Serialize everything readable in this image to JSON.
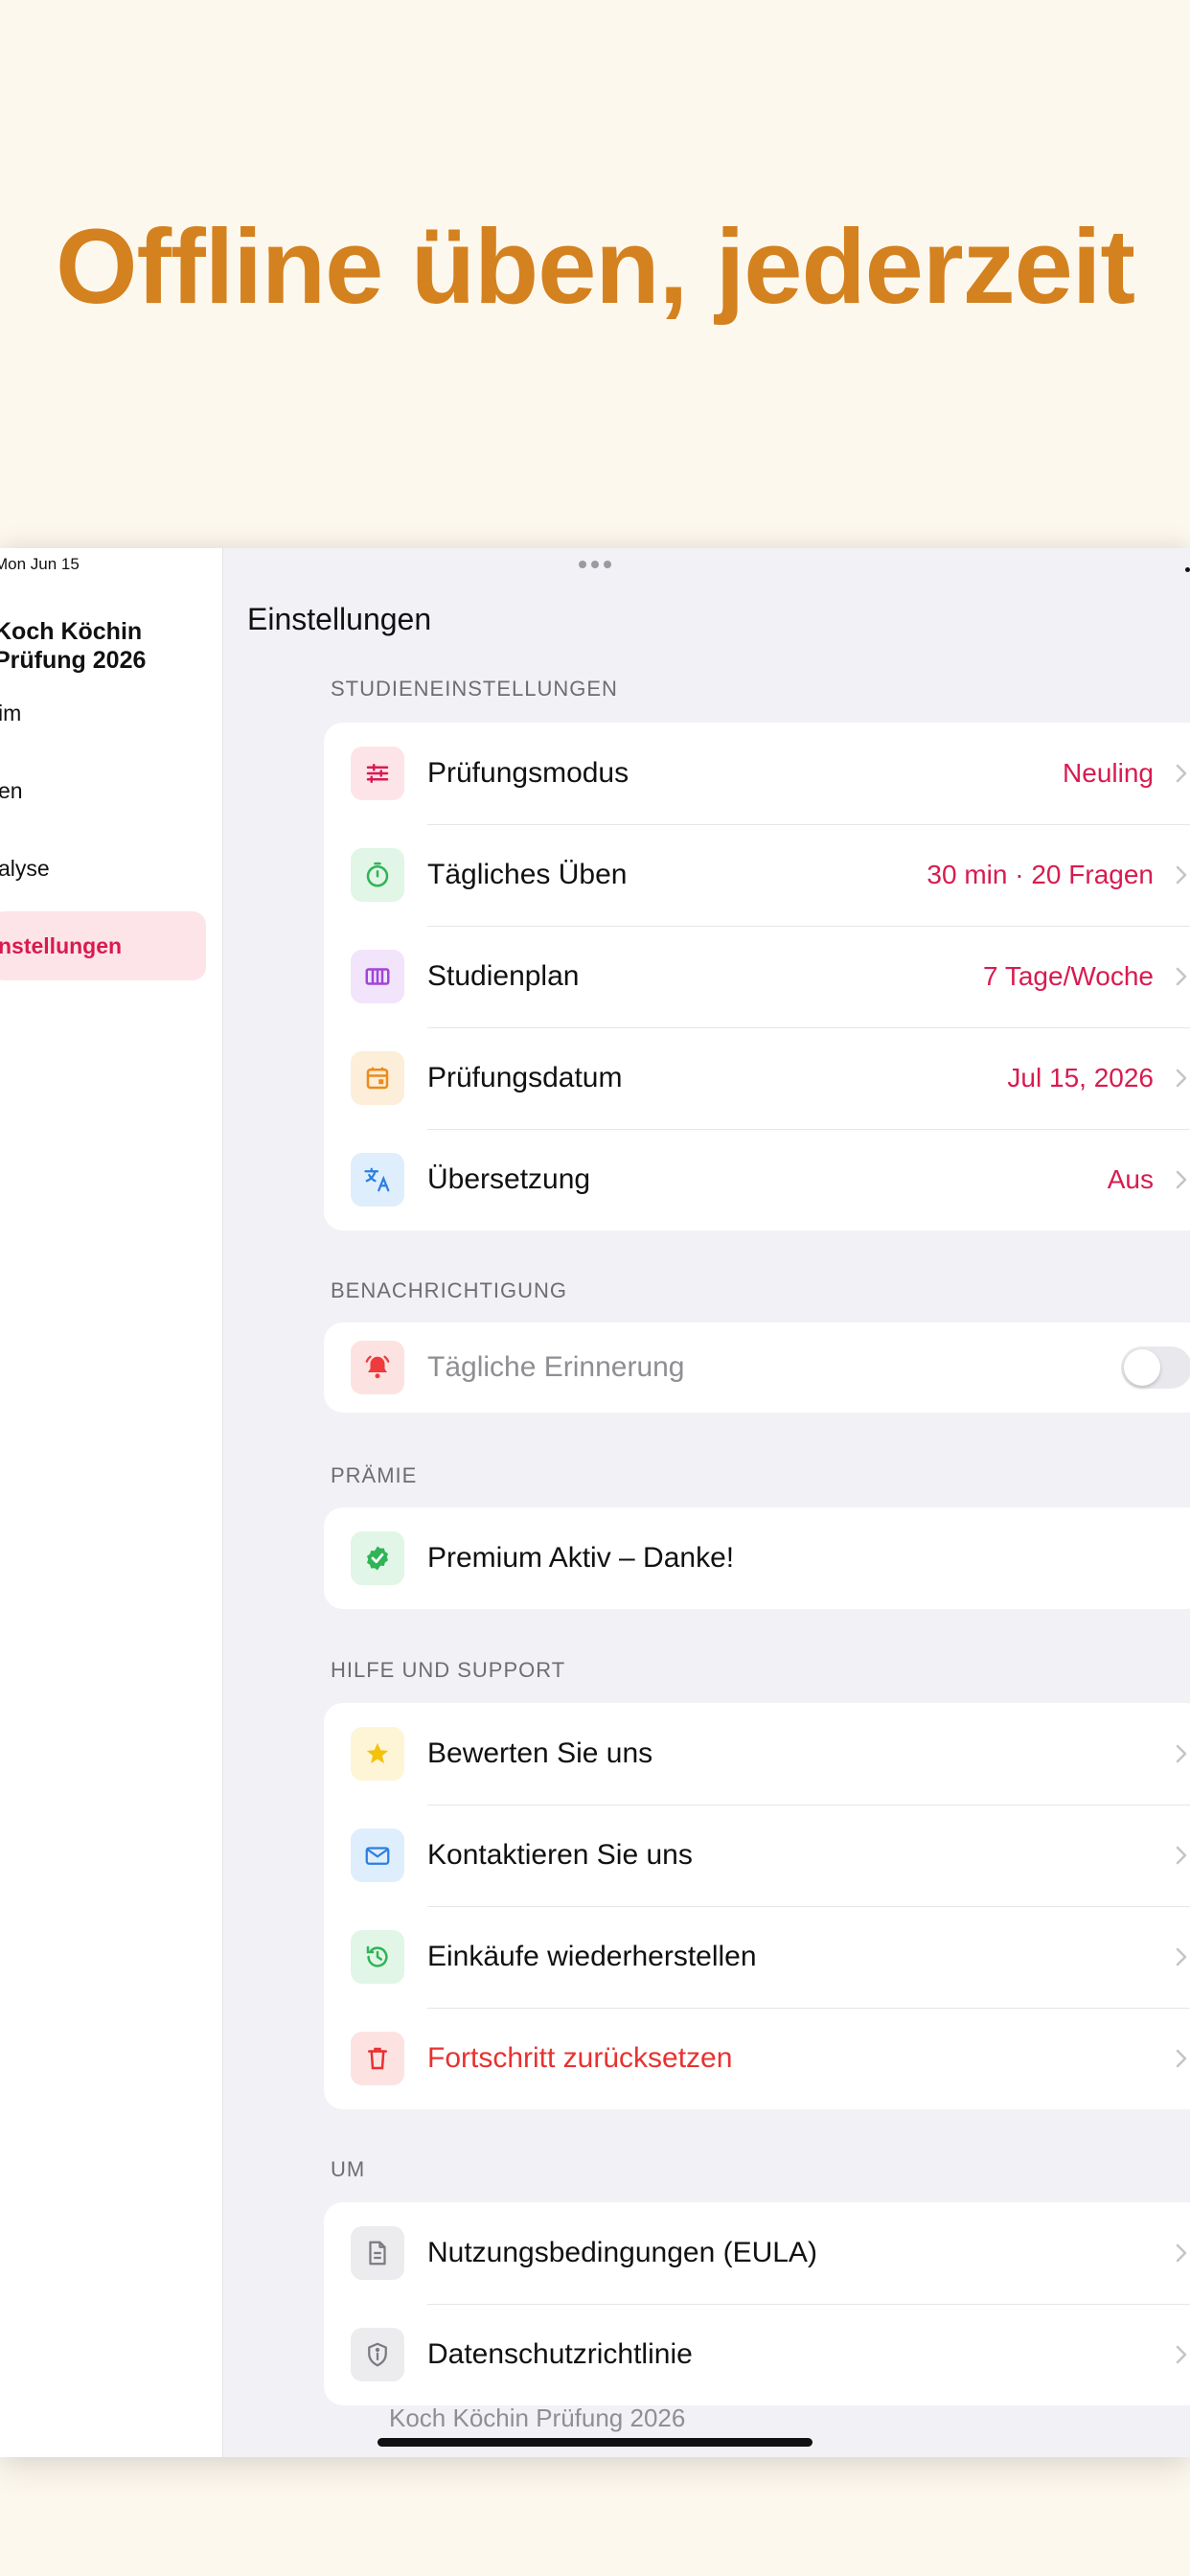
{
  "headline": "Offline üben, jederzeit",
  "status_bar": {
    "date": "Mon Jun 15"
  },
  "sidebar": {
    "app_title": "Koch Köchin Prüfung 2026",
    "items": [
      {
        "label": "im",
        "active": false
      },
      {
        "label": "en",
        "active": false
      },
      {
        "label": "alyse",
        "active": false
      },
      {
        "label": "nstellungen",
        "active": true
      }
    ]
  },
  "page_title": "Einstellungen",
  "sections": {
    "study": {
      "header": "STUDIENEINSTELLUNGEN",
      "rows": [
        {
          "label": "Prüfungsmodus",
          "value": "Neuling",
          "icon": "sliders-icon"
        },
        {
          "label": "Tägliches Üben",
          "value": "30 min · 20 Fragen",
          "icon": "timer-icon"
        },
        {
          "label": "Studienplan",
          "value": "7 Tage/Woche",
          "icon": "calendar-columns-icon"
        },
        {
          "label": "Prüfungsdatum",
          "value": "Jul 15, 2026",
          "icon": "calendar-icon"
        },
        {
          "label": "Übersetzung",
          "value": "Aus",
          "icon": "translate-icon"
        }
      ]
    },
    "notification": {
      "header": "BENACHRICHTIGUNG",
      "rows": [
        {
          "label": "Tägliche Erinnerung",
          "toggle": false,
          "icon": "bell-icon"
        }
      ]
    },
    "premium": {
      "header": "PRÄMIE",
      "rows": [
        {
          "label": "Premium Aktiv – Danke!",
          "icon": "verified-badge-icon"
        }
      ]
    },
    "help": {
      "header": "HILFE UND SUPPORT",
      "rows": [
        {
          "label": "Bewerten Sie uns",
          "icon": "star-icon"
        },
        {
          "label": "Kontaktieren Sie uns",
          "icon": "mail-icon"
        },
        {
          "label": "Einkäufe wiederherstellen",
          "icon": "restore-icon"
        },
        {
          "label": "Fortschritt zurücksetzen",
          "icon": "trash-icon"
        }
      ]
    },
    "about": {
      "header": "UM",
      "rows": [
        {
          "label": "Nutzungsbedingungen (EULA)",
          "icon": "document-icon"
        },
        {
          "label": "Datenschutzrichtlinie",
          "icon": "shield-icon"
        }
      ]
    }
  },
  "footer": "Koch Köchin Prüfung 2026",
  "colors": {
    "accent": "#d81b4f",
    "headline": "#d4811f",
    "danger": "#e8322f",
    "background": "#fdf8ee"
  }
}
